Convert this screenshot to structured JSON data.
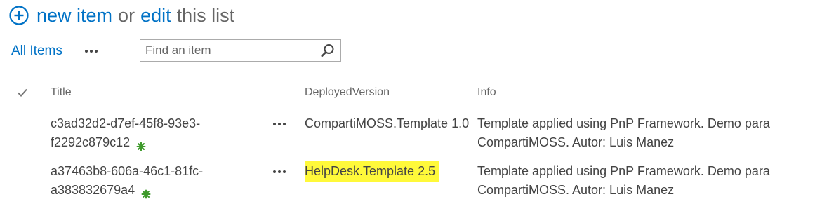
{
  "header": {
    "new_item_label": "new item",
    "or_label": "or",
    "edit_label": "edit",
    "this_list_label": "this list",
    "add_icon": "circle-plus-icon"
  },
  "toolbar": {
    "view_label": "All Items",
    "more_icon": "ellipsis-icon",
    "search": {
      "placeholder": "Find an item",
      "value": "",
      "icon": "magnifier-icon"
    }
  },
  "list": {
    "columns": {
      "select_icon": "checkmark-icon",
      "title": "Title",
      "deployed_version": "DeployedVersion",
      "info": "Info"
    },
    "rows": [
      {
        "title_line1": "c3ad32d2-d7ef-45f8-93e3-",
        "title_line2": "f2292c879c12",
        "new_badge_icon": "new-star-icon",
        "deployed_version": "CompartiMOSS.Template 1.0",
        "info": "Template applied using PnP Framework. Demo para CompartiMOSS. Autor: Luis Manez",
        "highlighted": false
      },
      {
        "title_line1": "a37463b8-606a-46c1-81fc-",
        "title_line2": "a383832679a4",
        "new_badge_icon": "new-star-icon",
        "deployed_version": "HelpDesk.Template 2.5",
        "info": "Template applied using PnP Framework. Demo para CompartiMOSS. Autor: Luis Manez",
        "highlighted": true
      }
    ]
  },
  "colors": {
    "link": "#0072c6",
    "text": "#444444",
    "muted": "#666666",
    "new_badge": "#3e9a2b",
    "highlight": "#fff93a"
  }
}
